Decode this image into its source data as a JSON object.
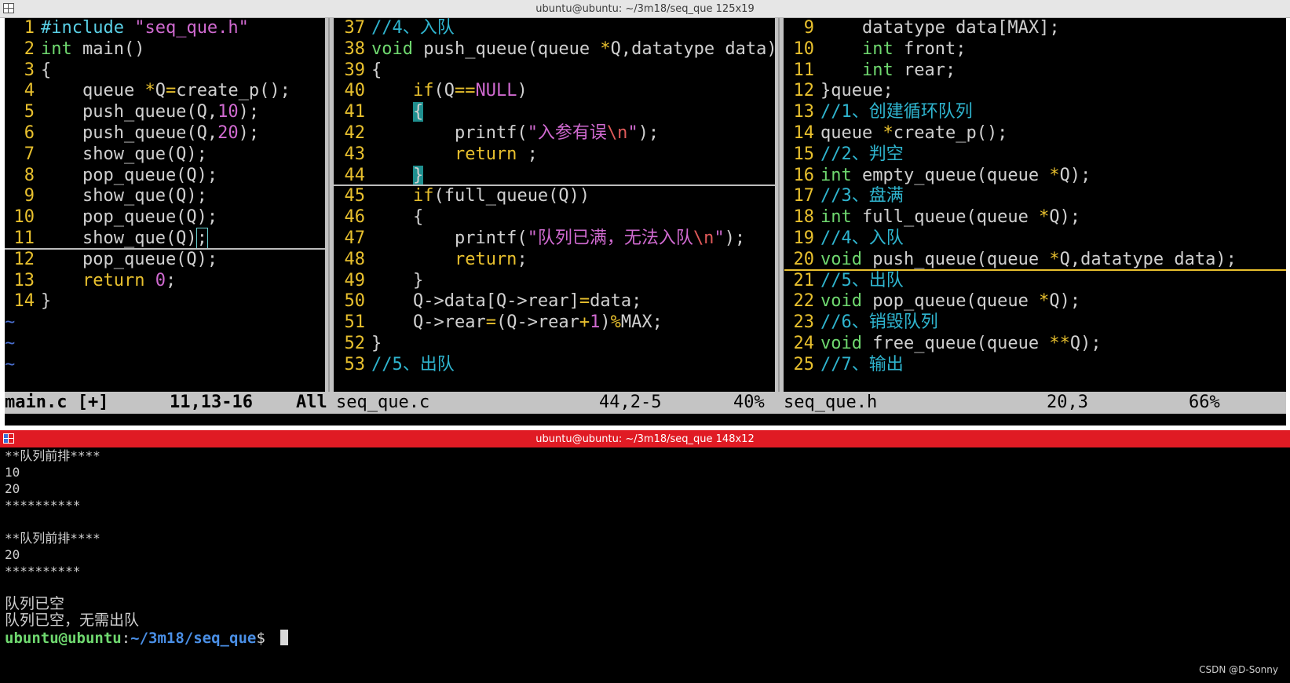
{
  "top_window": {
    "title": "ubuntu@ubuntu: ~/3m18/seq_que 125x19",
    "panes": [
      {
        "lines": [
          {
            "n": "1",
            "code": [
              [
                "pp",
                "#include "
              ],
              [
                "str",
                "\"seq_que.h\""
              ]
            ]
          },
          {
            "n": "2",
            "code": [
              [
                "ty",
                "int"
              ],
              [
                "pl",
                " main()"
              ]
            ]
          },
          {
            "n": "3",
            "code": [
              [
                "pl",
                "{"
              ]
            ]
          },
          {
            "n": "4",
            "code": [
              [
                "pl",
                "    queue "
              ],
              [
                "kw",
                "*"
              ],
              [
                "pl",
                "Q"
              ],
              [
                "kw",
                "="
              ],
              [
                "pl",
                "create_p();"
              ]
            ]
          },
          {
            "n": "5",
            "code": [
              [
                "pl",
                "    push_queue(Q,"
              ],
              [
                "num",
                "10"
              ],
              [
                "pl",
                ");"
              ]
            ]
          },
          {
            "n": "6",
            "code": [
              [
                "pl",
                "    push_queue(Q,"
              ],
              [
                "num",
                "20"
              ],
              [
                "pl",
                ");"
              ]
            ]
          },
          {
            "n": "7",
            "code": [
              [
                "pl",
                "    show_que(Q);"
              ]
            ]
          },
          {
            "n": "8",
            "code": [
              [
                "pl",
                "    pop_queue(Q);"
              ]
            ]
          },
          {
            "n": "9",
            "code": [
              [
                "pl",
                "    show_que(Q);"
              ]
            ]
          },
          {
            "n": "10",
            "code": [
              [
                "pl",
                "    pop_queue(Q);"
              ]
            ]
          },
          {
            "n": "11",
            "code": [
              [
                "pl",
                "    show_que(Q)"
              ],
              [
                "cur",
                ";"
              ]
            ],
            "cursorline": true
          },
          {
            "n": "12",
            "code": [
              [
                "pl",
                "    pop_queue(Q);"
              ]
            ]
          },
          {
            "n": "13",
            "code": [
              [
                "kw",
                "    return "
              ],
              [
                "num",
                "0"
              ],
              [
                "pl",
                ";"
              ]
            ]
          },
          {
            "n": "14",
            "code": [
              [
                "pl",
                "}"
              ]
            ]
          }
        ],
        "tildes": [
          "~",
          "~",
          "~"
        ],
        "status": {
          "file": "main.c [+]",
          "pos": "11,13-16",
          "pct": "All"
        }
      },
      {
        "lines": [
          {
            "n": "37",
            "code": [
              [
                "cm",
                "//4、入队"
              ]
            ]
          },
          {
            "n": "38",
            "code": [
              [
                "ty",
                "void"
              ],
              [
                "pl",
                " push_queue(queue "
              ],
              [
                "kw",
                "*"
              ],
              [
                "pl",
                "Q,datatype data)"
              ]
            ]
          },
          {
            "n": "39",
            "code": [
              [
                "pl",
                "{"
              ]
            ]
          },
          {
            "n": "40",
            "code": [
              [
                "kw",
                "    if"
              ],
              [
                "pl",
                "(Q"
              ],
              [
                "kw",
                "=="
              ],
              [
                "num",
                "NULL"
              ],
              [
                "pl",
                ")"
              ]
            ]
          },
          {
            "n": "41",
            "code": [
              [
                "pl",
                "    "
              ],
              [
                "hl",
                "{"
              ]
            ]
          },
          {
            "n": "42",
            "code": [
              [
                "pl",
                "        printf("
              ],
              [
                "str",
                "\"入参有误"
              ],
              [
                "esc",
                "\\n"
              ],
              [
                "str",
                "\""
              ],
              [
                "pl",
                ");"
              ]
            ]
          },
          {
            "n": "43",
            "code": [
              [
                "kw",
                "        return"
              ],
              [
                "pl",
                " ;"
              ]
            ]
          },
          {
            "n": "44",
            "code": [
              [
                "pl",
                "    "
              ],
              [
                "hl",
                "}"
              ]
            ],
            "cursorline": true
          },
          {
            "n": "45",
            "code": [
              [
                "kw",
                "    if"
              ],
              [
                "pl",
                "(full_queue(Q))"
              ]
            ]
          },
          {
            "n": "46",
            "code": [
              [
                "pl",
                "    {"
              ]
            ]
          },
          {
            "n": "47",
            "code": [
              [
                "pl",
                "        printf("
              ],
              [
                "str",
                "\"队列已满，无法入队"
              ],
              [
                "esc",
                "\\n"
              ],
              [
                "str",
                "\""
              ],
              [
                "pl",
                ");"
              ]
            ]
          },
          {
            "n": "48",
            "code": [
              [
                "kw",
                "        return"
              ],
              [
                "pl",
                ";"
              ]
            ]
          },
          {
            "n": "49",
            "code": [
              [
                "pl",
                "    }"
              ]
            ]
          },
          {
            "n": "50",
            "code": [
              [
                "pl",
                "    Q->data[Q->rear]"
              ],
              [
                "kw",
                "="
              ],
              [
                "pl",
                "data;"
              ]
            ]
          },
          {
            "n": "51",
            "code": [
              [
                "pl",
                "    Q->rear"
              ],
              [
                "kw",
                "="
              ],
              [
                "pl",
                "(Q->rear"
              ],
              [
                "kw",
                "+"
              ],
              [
                "num",
                "1"
              ],
              [
                "pl",
                ")"
              ],
              [
                "kw",
                "%"
              ],
              [
                "pl",
                "MAX;"
              ]
            ]
          },
          {
            "n": "52",
            "code": [
              [
                "pl",
                "}"
              ]
            ]
          },
          {
            "n": "53",
            "code": [
              [
                "cm",
                "//5、出队"
              ]
            ]
          }
        ],
        "tildes": [],
        "status": {
          "file": "seq_que.c",
          "pos": "44,2-5",
          "pct": "40%"
        }
      },
      {
        "lines": [
          {
            "n": "9",
            "code": [
              [
                "pl",
                "    datatype data[MAX];"
              ]
            ]
          },
          {
            "n": "10",
            "code": [
              [
                "ty",
                "    int"
              ],
              [
                "pl",
                " front;"
              ]
            ]
          },
          {
            "n": "11",
            "code": [
              [
                "ty",
                "    int"
              ],
              [
                "pl",
                " rear;"
              ]
            ]
          },
          {
            "n": "12",
            "code": [
              [
                "pl",
                "}queue;"
              ]
            ]
          },
          {
            "n": "13",
            "code": [
              [
                "cm",
                "//1、创建循环队列"
              ]
            ]
          },
          {
            "n": "14",
            "code": [
              [
                "pl",
                "queue "
              ],
              [
                "kw",
                "*"
              ],
              [
                "pl",
                "create_p();"
              ]
            ]
          },
          {
            "n": "15",
            "code": [
              [
                "cm",
                "//2、判空"
              ]
            ]
          },
          {
            "n": "16",
            "code": [
              [
                "ty",
                "int"
              ],
              [
                "pl",
                " empty_queue(queue "
              ],
              [
                "kw",
                "*"
              ],
              [
                "pl",
                "Q);"
              ]
            ]
          },
          {
            "n": "17",
            "code": [
              [
                "cm",
                "//3、盘满"
              ]
            ]
          },
          {
            "n": "18",
            "code": [
              [
                "ty",
                "int"
              ],
              [
                "pl",
                " full_queue(queue "
              ],
              [
                "kw",
                "*"
              ],
              [
                "pl",
                "Q);"
              ]
            ]
          },
          {
            "n": "19",
            "code": [
              [
                "cm",
                "//4、入队"
              ]
            ]
          },
          {
            "n": "20",
            "code": [
              [
                "ty",
                "void"
              ],
              [
                "pl",
                " push_queue(queue "
              ],
              [
                "kw",
                "*"
              ],
              [
                "pl",
                "Q,datatype data);"
              ]
            ],
            "cursorline": true,
            "yellow": true
          },
          {
            "n": "21",
            "code": [
              [
                "cm",
                "//5、出队"
              ]
            ]
          },
          {
            "n": "22",
            "code": [
              [
                "ty",
                "void"
              ],
              [
                "pl",
                " pop_queue(queue "
              ],
              [
                "kw",
                "*"
              ],
              [
                "pl",
                "Q);"
              ]
            ]
          },
          {
            "n": "23",
            "code": [
              [
                "cm",
                "//6、销毁队列"
              ]
            ]
          },
          {
            "n": "24",
            "code": [
              [
                "ty",
                "void"
              ],
              [
                "pl",
                " free_queue(queue "
              ],
              [
                "kw",
                "**"
              ],
              [
                "pl",
                "Q);"
              ]
            ]
          },
          {
            "n": "25",
            "code": [
              [
                "cm",
                "//7、输出"
              ]
            ]
          }
        ],
        "tildes": [],
        "status": {
          "file": "seq_que.h",
          "pos": "20,3",
          "pct": "66%"
        }
      }
    ]
  },
  "bottom_window": {
    "title": "ubuntu@ubuntu: ~/3m18/seq_que 148x12",
    "output": [
      {
        "text": "**队列前排****",
        "big": false
      },
      {
        "text": "10",
        "big": false
      },
      {
        "text": "20",
        "big": false
      },
      {
        "text": "**********",
        "big": false
      },
      {
        "text": "",
        "big": false
      },
      {
        "text": "**队列前排****",
        "big": false
      },
      {
        "text": "20",
        "big": false
      },
      {
        "text": "**********",
        "big": false
      },
      {
        "text": "",
        "big": false
      },
      {
        "text": "队列已空",
        "big": true
      },
      {
        "text": "队列已空，无需出队",
        "big": true
      }
    ],
    "prompt": {
      "user": "ubuntu@ubuntu",
      "sep": ":",
      "path": "~/3m18/seq_que",
      "sym": "$ "
    },
    "watermark": "CSDN @D-Sonny"
  }
}
